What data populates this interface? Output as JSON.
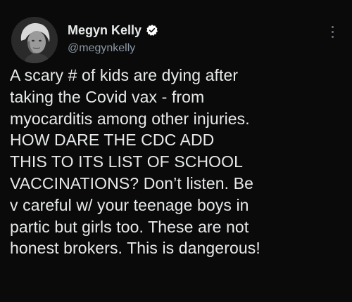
{
  "tweet": {
    "author": {
      "display_name": "Megyn Kelly",
      "handle": "@megynkelly",
      "verified_icon": "verified-badge-icon",
      "avatar_icon": "profile-photo"
    },
    "text": "A scary # of kids are dying after\ntaking the Covid vax - from\nmyocarditis among other injuries.\nHOW DARE THE CDC ADD\nTHIS TO ITS LIST OF SCHOOL\nVACCINATIONS? Don’t listen. Be\nv careful w/ your teenage boys in\npartic but girls too. These are not\nhonest brokers. This is dangerous!",
    "more_icon": "more-options-icon"
  },
  "colors": {
    "background": "#0a0a0a",
    "text": "#e7e9ea",
    "secondary_text": "#8b98a5",
    "verified": "#ffffff"
  }
}
